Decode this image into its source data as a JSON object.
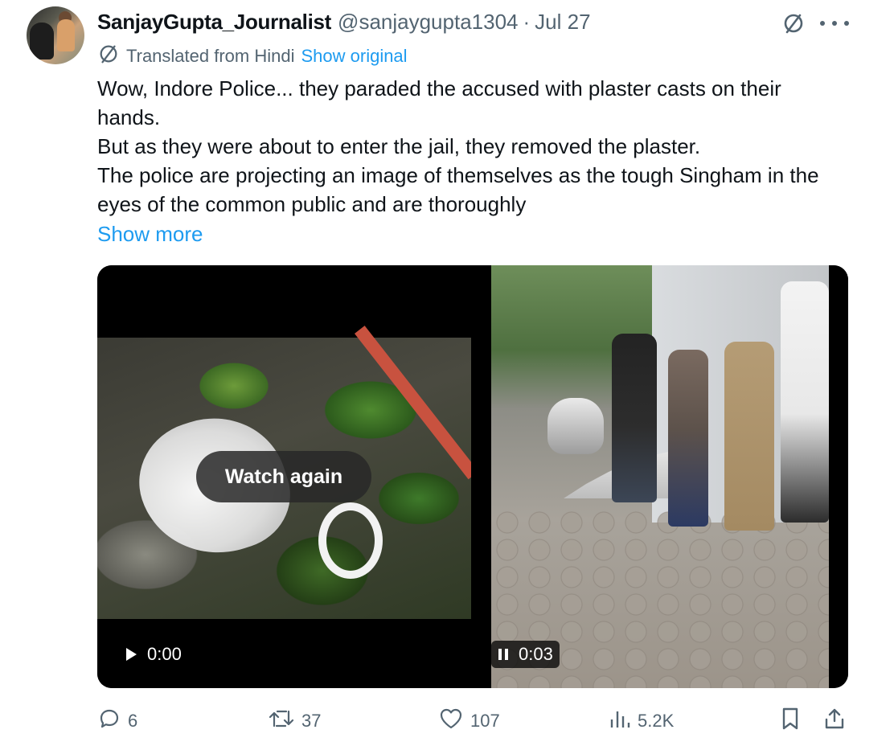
{
  "tweet": {
    "author_name": "SanjayGupta_Journalist",
    "handle": "@sanjaygupta1304",
    "separator": "·",
    "date": "Jul 27",
    "translated_label": "Translated from Hindi",
    "show_original_label": "Show original",
    "lines": [
      "Wow, Indore Police... they paraded the accused with plaster casts on their hands.",
      "But as they were about to enter the jail, they removed the plaster.",
      "The police are projecting an image of themselves as the tough Singham in the eyes of the common public and are thoroughly"
    ],
    "show_more_label": "Show more"
  },
  "media": {
    "left_video": {
      "overlay_label": "Watch again",
      "time": "0:00",
      "state": "play-icon"
    },
    "right_video": {
      "time": "0:03",
      "state": "pause-icon"
    }
  },
  "actions": {
    "replies": "6",
    "reposts": "37",
    "likes": "107",
    "views": "5.2K"
  },
  "icons": [
    "translate-icon",
    "more-icon",
    "reply-icon",
    "repost-icon",
    "like-icon",
    "views-icon",
    "bookmark-icon",
    "share-icon"
  ],
  "colors": {
    "link": "#1d9bf0",
    "muted": "#536471",
    "text": "#0f1419"
  }
}
